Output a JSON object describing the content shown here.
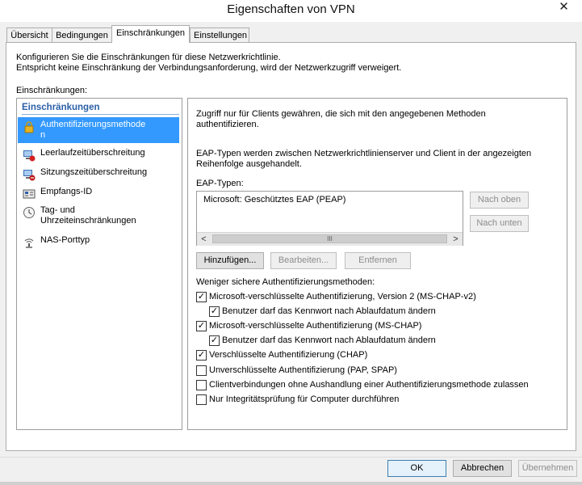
{
  "window": {
    "title": "Eigenschaften von VPN",
    "close_glyph": "✕"
  },
  "tabs": [
    "Übersicht",
    "Bedingungen",
    "Einschränkungen",
    "Einstellungen"
  ],
  "active_tab": "Einschränkungen",
  "intro": {
    "line1": "Konfigurieren Sie die Einschränkungen für diese Netzwerkrichtlinie.",
    "line2": "Entspricht keine Einschränkung der Verbindungsanforderung, wird der Netzwerkzugriff verweigert.",
    "section_label": "Einschränkungen:"
  },
  "sidebar": {
    "header": "Einschränkungen",
    "items": [
      {
        "label": "Authentifizierungsmethode\nn",
        "icon": "lock-icon",
        "selected": true
      },
      {
        "label": "Leerlaufzeitüberschreitung",
        "icon": "idle-timeout-icon"
      },
      {
        "label": "Sitzungszeitüberschreitung",
        "icon": "session-timeout-icon"
      },
      {
        "label": "Empfangs-ID",
        "icon": "called-station-id-icon"
      },
      {
        "label": "Tag- und\nUhrzeiteinschränkungen",
        "icon": "clock-icon"
      },
      {
        "label": "NAS-Porttyp",
        "icon": "nas-port-icon"
      }
    ]
  },
  "main": {
    "desc1": "Zugriff nur für Clients gewähren, die sich mit den angegebenen Methoden\nauthentifizieren.",
    "desc2": "EAP-Typen werden zwischen Netzwerkrichtlinienserver und Client in der angezeigten\nReihenfolge ausgehandelt.",
    "eap_label": "EAP-Typen:",
    "eap_items": [
      "Microsoft: Geschütztes EAP (PEAP)"
    ],
    "scroll": {
      "left": "<",
      "right": ">",
      "thumb": "III"
    },
    "move_up": "Nach oben",
    "move_down": "Nach unten",
    "add": "Hinzufügen...",
    "edit": "Bearbeiten...",
    "remove": "Entfernen",
    "less_secure_label": "Weniger sichere Authentifizierungsmethoden:",
    "checkboxes": [
      {
        "label": "Microsoft-verschlüsselte Authentifizierung, Version 2 (MS-CHAP-v2)",
        "checked": true
      },
      {
        "label": "Benutzer darf das Kennwort nach Ablaufdatum ändern",
        "checked": true
      },
      {
        "label": "Microsoft-verschlüsselte Authentifizierung (MS-CHAP)",
        "checked": true
      },
      {
        "label": "Benutzer darf das Kennwort nach Ablaufdatum ändern",
        "checked": true
      },
      {
        "label": "Verschlüsselte Authentifizierung (CHAP)",
        "checked": true
      },
      {
        "label": "Unverschlüsselte Authentifizierung (PAP, SPAP)",
        "checked": false
      },
      {
        "label": "Clientverbindungen ohne Aushandlung einer Authentifizierungsmethode zulassen",
        "checked": false
      },
      {
        "label": "Nur Integritätsprüfung für Computer durchführen",
        "checked": false
      }
    ]
  },
  "footer": {
    "ok": "OK",
    "cancel": "Abbrechen",
    "apply": "Übernehmen"
  }
}
